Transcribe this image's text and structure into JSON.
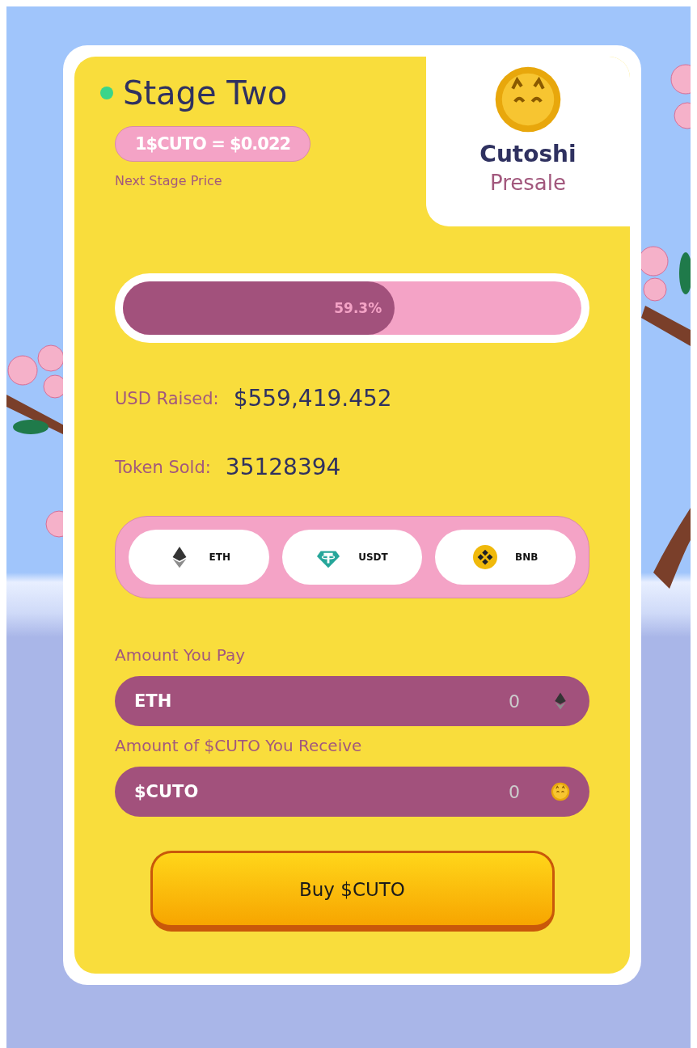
{
  "stage": {
    "title": "Stage Two",
    "live": true,
    "price": "1$CUTO = $0.022",
    "price_caption": "Next Stage Price"
  },
  "brand": {
    "name": "Cutoshi",
    "subtitle": "Presale"
  },
  "progress": {
    "level": 0.593,
    "label": "59.3%"
  },
  "stats": [
    {
      "label": "USD Raised:",
      "value": "$559,419.452"
    },
    {
      "label": "Token Sold:",
      "value": "35128394"
    }
  ],
  "currencies": [
    {
      "kind": "eth",
      "label": "ETH"
    },
    {
      "kind": "usdt",
      "label": "USDT"
    },
    {
      "kind": "bnb",
      "label": "BNB"
    }
  ],
  "fields": [
    {
      "label": "Amount You Pay",
      "currency": "ETH",
      "placeholder": "0",
      "kind": "eth"
    },
    {
      "label": "Amount of $CUTO You Receive",
      "currency": "$CUTO",
      "placeholder": "0",
      "kind": "coin"
    }
  ],
  "buy_button": "Buy $CUTO"
}
